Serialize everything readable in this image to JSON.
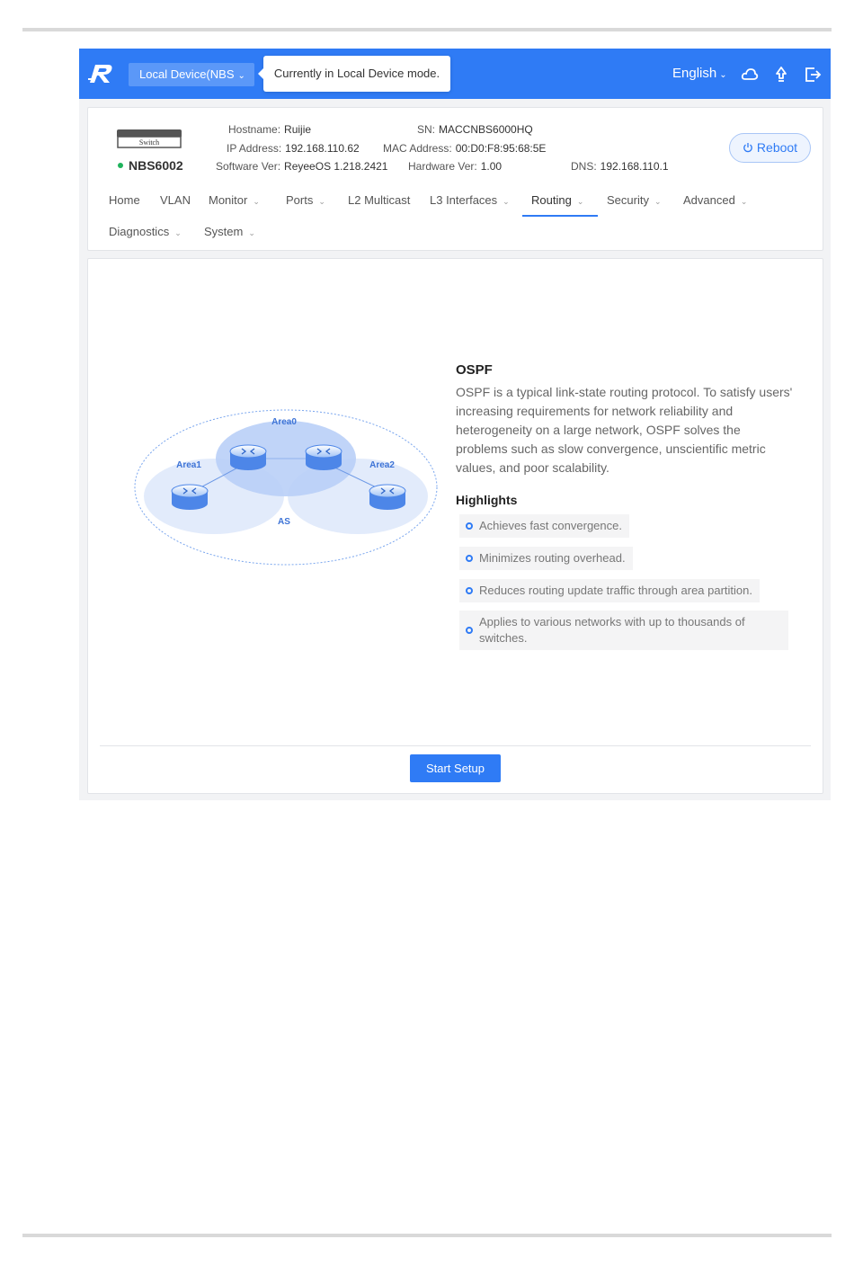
{
  "header": {
    "device_selector": "Local Device(NBS",
    "tooltip": "Currently in Local Device mode.",
    "language": "English"
  },
  "device": {
    "badge": "Switch",
    "name": "NBS6002",
    "status_color": "#1fb35c",
    "hostname_label": "Hostname:",
    "hostname": "Ruijie",
    "sn_label": "SN:",
    "sn": "MACCNBS6000HQ",
    "ip_label": "IP Address:",
    "ip": "192.168.110.62",
    "mac_label": "MAC Address:",
    "mac": "00:D0:F8:95:68:5E",
    "sw_label": "Software Ver:",
    "sw": "ReyeeOS 1.218.2421",
    "hw_label": "Hardware Ver:",
    "hw": "1.00",
    "dns_label": "DNS:",
    "dns": "192.168.110.1",
    "reboot_label": "Reboot"
  },
  "nav": [
    {
      "label": "Home"
    },
    {
      "label": "VLAN"
    },
    {
      "label": "Monitor"
    },
    {
      "label": "Ports"
    },
    {
      "label": "L2 Multicast"
    },
    {
      "label": "L3 Interfaces"
    },
    {
      "label": "Routing"
    },
    {
      "label": "Security"
    },
    {
      "label": "Advanced"
    },
    {
      "label": "Diagnostics"
    },
    {
      "label": "System"
    }
  ],
  "diagram": {
    "area0": "Area0",
    "area1": "Area1",
    "area2": "Area2",
    "as": "AS"
  },
  "ospf": {
    "title": "OSPF",
    "description": "OSPF is a typical link-state routing protocol. To satisfy users'    increasing requirements for network reliability and heterogeneity on a large network, OSPF solves the problems such as slow convergence, unscientific metric values, and poor scalability.",
    "highlights_title": "Highlights",
    "highlights": [
      "Achieves fast convergence.",
      "Minimizes routing overhead.",
      "Reduces routing update traffic through area partition.",
      "Applies to various networks with up to thousands of switches."
    ]
  },
  "actions": {
    "start_setup": "Start Setup"
  },
  "colors": {
    "brand": "#2f7bf5",
    "status": "#1fb35c"
  }
}
